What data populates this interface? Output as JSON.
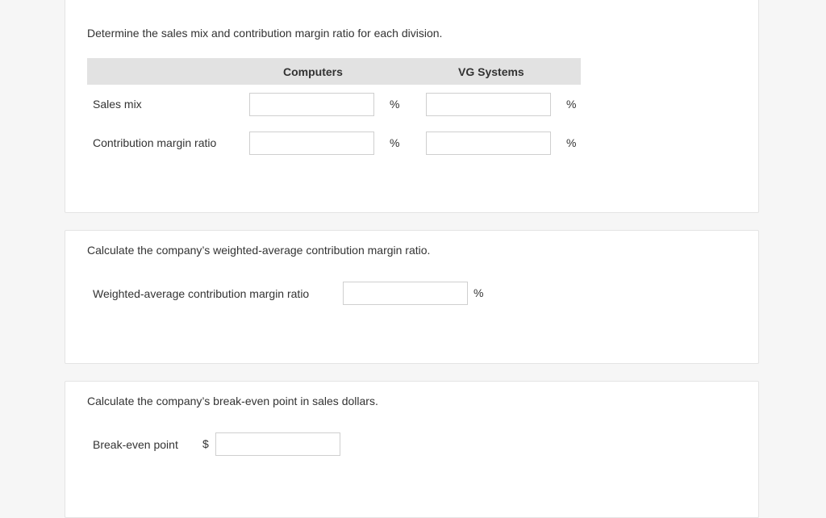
{
  "section1": {
    "question": "Determine the sales mix and contribution margin ratio for each division.",
    "columns": [
      "Computers",
      "VG Systems"
    ],
    "rows": [
      {
        "label": "Sales mix",
        "computers_value": "",
        "vg_value": "",
        "unit": "%"
      },
      {
        "label": "Contribution margin ratio",
        "computers_value": "",
        "vg_value": "",
        "unit": "%"
      }
    ]
  },
  "section2": {
    "question": "Calculate the company’s weighted-average contribution margin ratio.",
    "label": "Weighted-average contribution margin ratio",
    "value": "",
    "unit": "%"
  },
  "section3": {
    "question": "Calculate the company’s break-even point in sales dollars.",
    "label": "Break-even point",
    "currency": "$",
    "value": ""
  }
}
